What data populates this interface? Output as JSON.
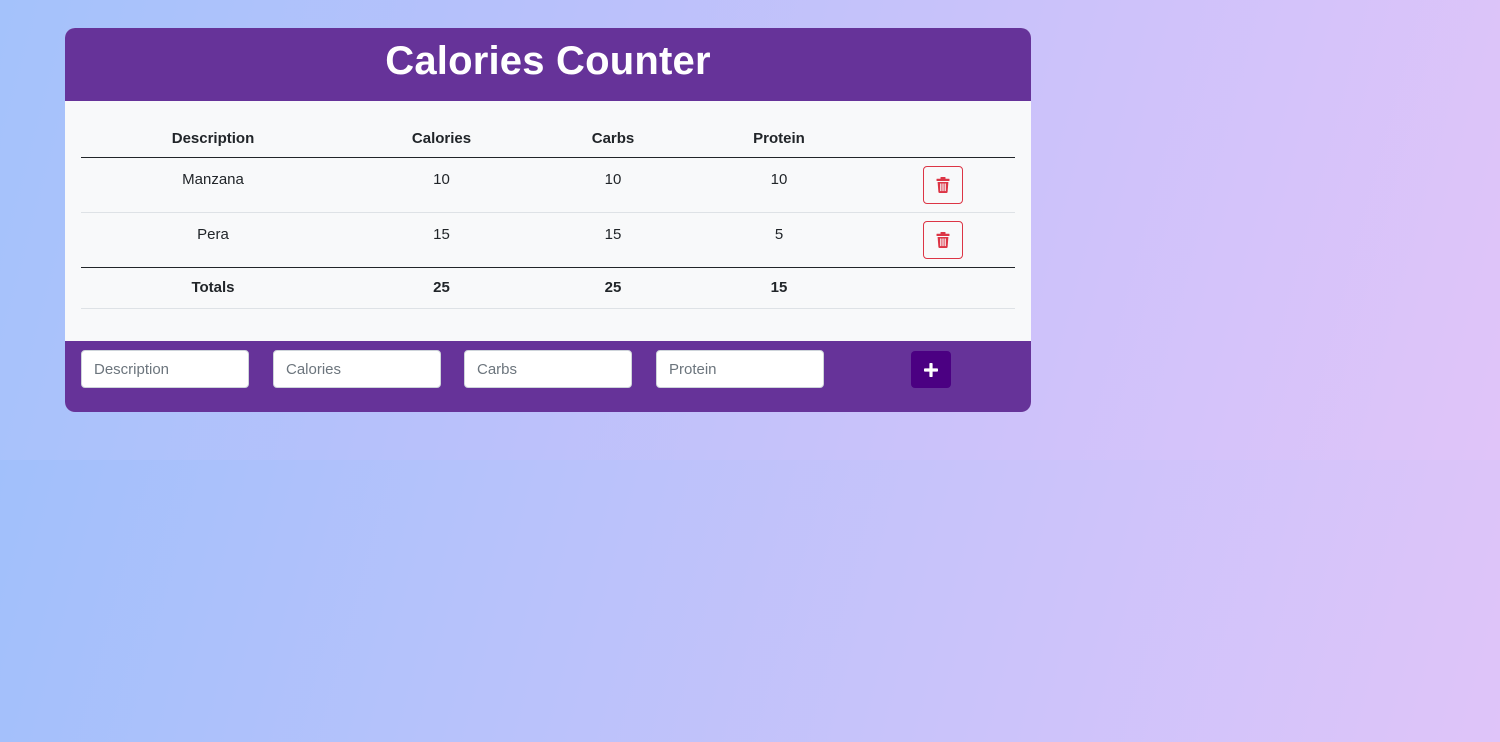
{
  "header": {
    "title": "Calories Counter"
  },
  "table": {
    "columns": [
      "Description",
      "Calories",
      "Carbs",
      "Protein"
    ],
    "rows": [
      {
        "description": "Manzana",
        "calories": "10",
        "carbs": "10",
        "protein": "10"
      },
      {
        "description": "Pera",
        "calories": "15",
        "carbs": "15",
        "protein": "5"
      }
    ],
    "totals": {
      "label": "Totals",
      "calories": "25",
      "carbs": "25",
      "protein": "15"
    }
  },
  "form": {
    "description_placeholder": "Description",
    "calories_placeholder": "Calories",
    "carbs_placeholder": "Carbs",
    "protein_placeholder": "Protein",
    "description_value": "",
    "calories_value": "",
    "carbs_value": "",
    "protein_value": ""
  },
  "icons": {
    "delete": "trash-icon",
    "add": "plus-icon"
  },
  "colors": {
    "primary": "#663399",
    "add_button": "#4b0082",
    "danger": "#dc3545",
    "table_bg": "#f8f9fa"
  }
}
